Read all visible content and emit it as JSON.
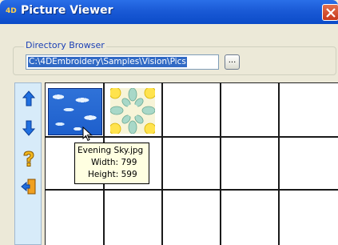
{
  "window": {
    "title": "Picture Viewer",
    "app_icon_text": "4D"
  },
  "directory_browser": {
    "label": "Directory Browser",
    "path": "C:\\4DEmbroidery\\Samples\\Vision\\Pics",
    "browse_label": "..."
  },
  "toolbar": {
    "tools": [
      "up-arrow-icon",
      "down-arrow-icon",
      "question-mark-icon",
      "exit-door-icon"
    ]
  },
  "grid": {
    "columns": 5,
    "rows": 3,
    "thumbnails": [
      "sky-thumbnail",
      "flowers-thumbnail"
    ]
  },
  "tooltip": {
    "filename": "Evening Sky.jpg",
    "width": "Width: 799",
    "height": "Height: 599"
  },
  "colors": {
    "titlebar": "#0b4bc8",
    "selection": "#316ac5",
    "tooltip_bg": "#ffffe1",
    "toolbar_bg": "#d7ebf9"
  }
}
